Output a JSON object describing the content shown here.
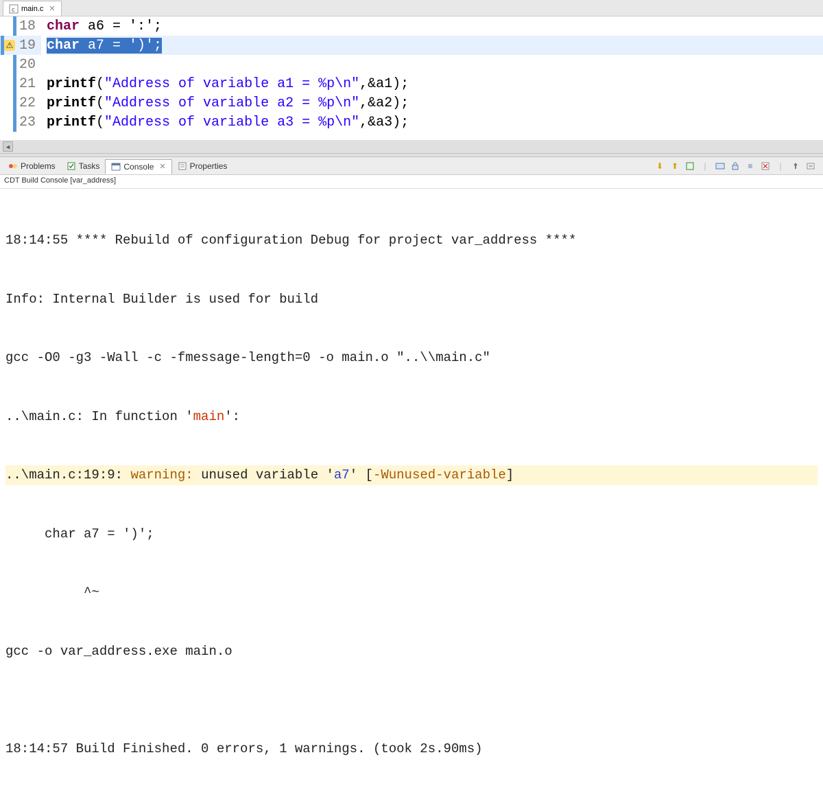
{
  "editor": {
    "tab_label": "main.c",
    "lines": [
      {
        "num": "18",
        "changed": true,
        "warn": false,
        "current": false
      },
      {
        "num": "19",
        "changed": true,
        "warn": true,
        "current": true
      },
      {
        "num": "20",
        "changed": true,
        "warn": false,
        "current": false
      },
      {
        "num": "21",
        "changed": true,
        "warn": false,
        "current": false
      },
      {
        "num": "22",
        "changed": true,
        "warn": false,
        "current": false
      },
      {
        "num": "23",
        "changed": true,
        "warn": false,
        "current": false
      }
    ],
    "code": {
      "l18_kw": "char",
      "l18_rest": " a6 = ':';",
      "l19_kw": "char",
      "l19_rest": " a7 = ')';",
      "l21_fn": "printf",
      "l21_paren": "(",
      "l21_str": "\"Address of variable a1 = %p\\n\"",
      "l21_rest": ",&a1);",
      "l22_fn": "printf",
      "l22_paren": "(",
      "l22_str": "\"Address of variable a2 = %p\\n\"",
      "l22_rest": ",&a2);",
      "l23_fn": "printf",
      "l23_paren": "(",
      "l23_str": "\"Address of variable a3 = %p\\n\"",
      "l23_rest": ",&a3);"
    }
  },
  "bottom": {
    "tabs": {
      "problems": "Problems",
      "tasks": "Tasks",
      "console": "Console",
      "properties": "Properties"
    },
    "console_label": "CDT Build Console [var_address]",
    "lines": {
      "l1_time": "18:14:55 ",
      "l1_rest": "**** Rebuild of configuration Debug for project var_address ****",
      "l2": "Info: Internal Builder is used for build",
      "l3": "gcc -O0 -g3 -Wall -c -fmessage-length=0 -o main.o \"..\\\\main.c\"",
      "l4_a": "..\\main.c: In function '",
      "l4_fn": "main",
      "l4_b": "':",
      "l5_a": "..\\main.c:19:9: ",
      "l5_warn": "warning: ",
      "l5_b": "unused variable '",
      "l5_var": "a7",
      "l5_c": "' [",
      "l5_flag": "-Wunused-variable",
      "l5_d": "]",
      "l6": "     char a7 = ')';",
      "l7": "          ^~",
      "l8": "gcc -o var_address.exe main.o",
      "l9": "",
      "l10": "18:14:57 Build Finished. 0 errors, 1 warnings. (took 2s.90ms)"
    }
  }
}
